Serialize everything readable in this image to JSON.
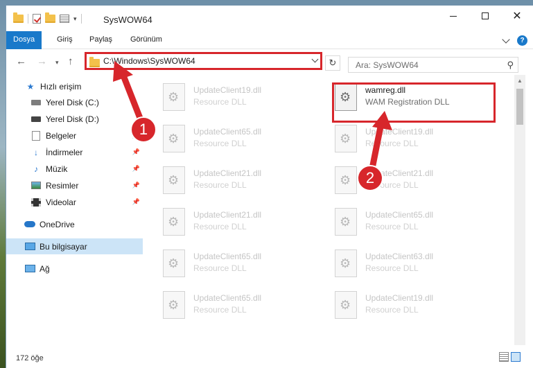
{
  "window": {
    "title": "SysWOW64"
  },
  "ribbon": {
    "tabs": [
      "Dosya",
      "Giriş",
      "Paylaş",
      "Görünüm"
    ]
  },
  "address": {
    "path": "C:\\Windows\\SysWOW64"
  },
  "search": {
    "placeholder": "Ara: SysWOW64"
  },
  "sidebar": {
    "items": [
      {
        "label": "Hızlı erişim",
        "icon": "star-icon",
        "pinned": false
      },
      {
        "label": "Yerel Disk (C:)",
        "icon": "drive-icon",
        "pinned": false
      },
      {
        "label": "Yerel Disk (D:)",
        "icon": "drive-icon",
        "pinned": false
      },
      {
        "label": "Belgeler",
        "icon": "document-icon",
        "pinned": true
      },
      {
        "label": "İndirmeler",
        "icon": "download-icon",
        "pinned": true
      },
      {
        "label": "Müzik",
        "icon": "music-icon",
        "pinned": true
      },
      {
        "label": "Resimler",
        "icon": "picture-icon",
        "pinned": true
      },
      {
        "label": "Videolar",
        "icon": "video-icon",
        "pinned": true
      },
      {
        "label": "OneDrive",
        "icon": "cloud-icon",
        "pinned": false
      },
      {
        "label": "Bu bilgisayar",
        "icon": "computer-icon",
        "pinned": false,
        "selected": true
      },
      {
        "label": "Ağ",
        "icon": "network-icon",
        "pinned": false
      }
    ]
  },
  "files": [
    {
      "name": "UpdateClient19.dll",
      "type": "Resource DLL"
    },
    {
      "name": "wamreg.dll",
      "type": "WAM Registration DLL",
      "highlighted": true
    },
    {
      "name": "UpdateClient65.dll",
      "type": "Resource DLL"
    },
    {
      "name": "UpdateClient19.dll",
      "type": "Resource DLL"
    },
    {
      "name": "UpdateClient21.dll",
      "type": "Resource DLL"
    },
    {
      "name": "UpdateClient21.dll",
      "type": "Resource DLL"
    },
    {
      "name": "UpdateClient21.dll",
      "type": "Resource DLL"
    },
    {
      "name": "UpdateClient65.dll",
      "type": "Resource DLL"
    },
    {
      "name": "UpdateClient65.dll",
      "type": "Resource DLL"
    },
    {
      "name": "UpdateClient63.dll",
      "type": "Resource DLL"
    },
    {
      "name": "UpdateClient65.dll",
      "type": "Resource DLL"
    },
    {
      "name": "UpdateClient19.dll",
      "type": "Resource DLL"
    }
  ],
  "status": {
    "item_count": "172 öğe"
  },
  "annotations": {
    "step1": "1",
    "step2": "2",
    "color": "#d7262b"
  }
}
